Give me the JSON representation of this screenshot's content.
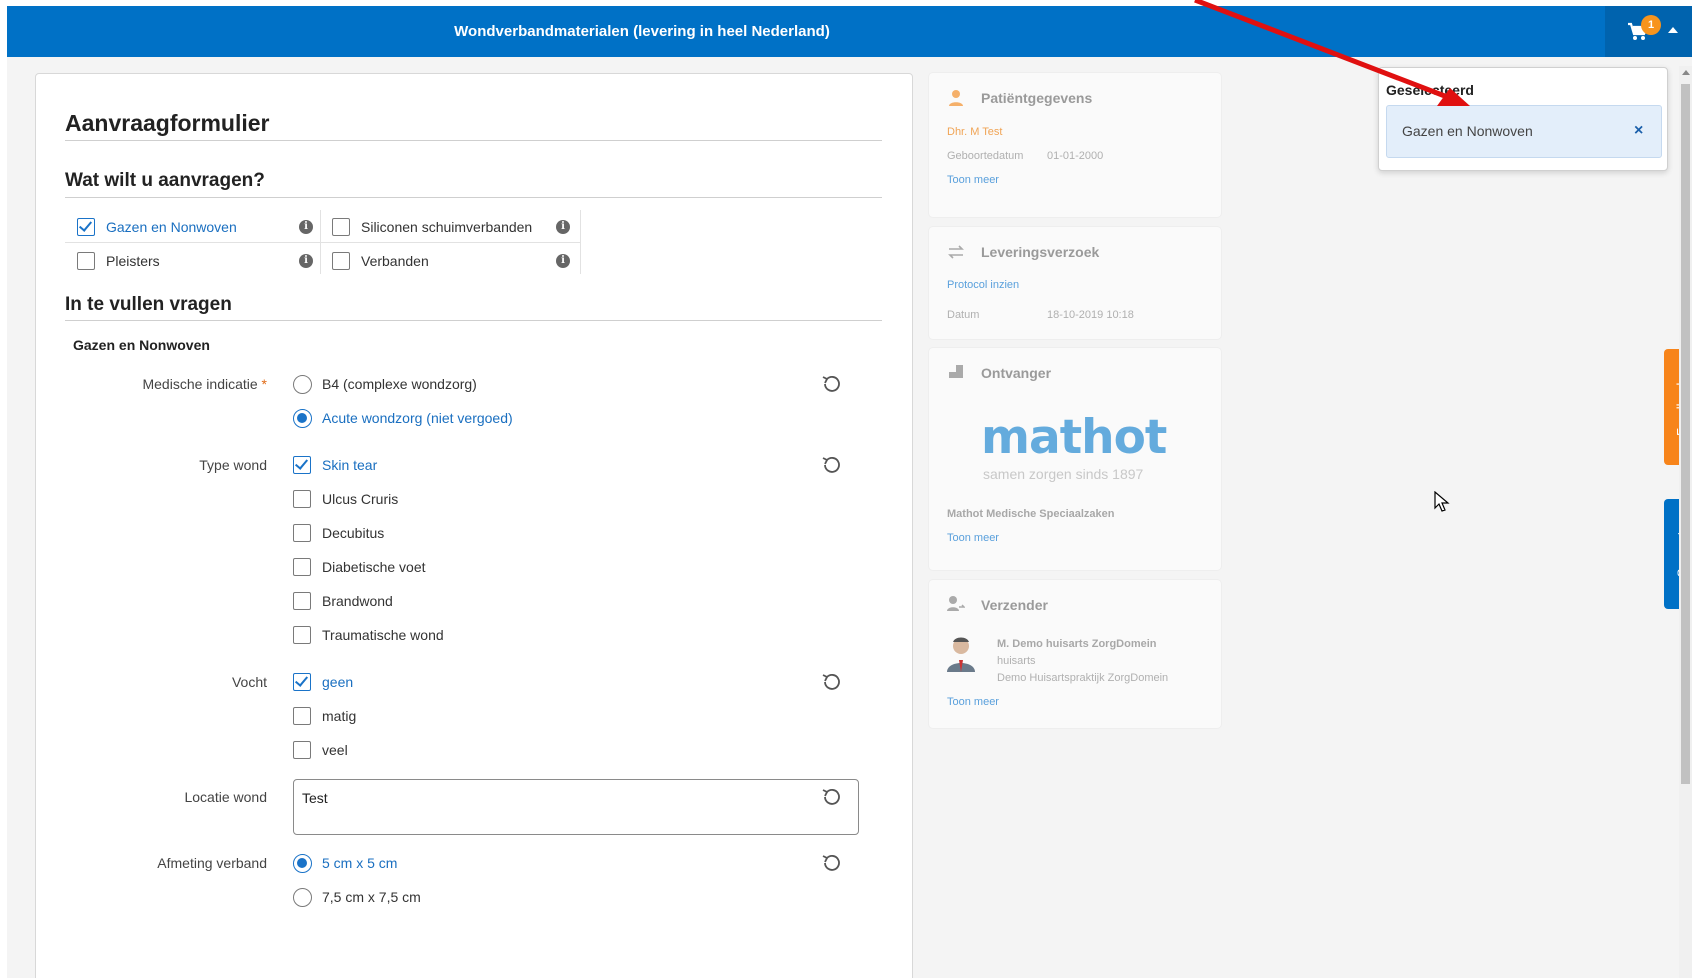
{
  "topbar": {
    "title": "Wondverbandmaterialen (levering in heel Nederland)",
    "cart_count": "1"
  },
  "colors": {
    "primary": "#0071c6",
    "accent": "#f7941d",
    "feedback": "#f7841a"
  },
  "form": {
    "title": "Aanvraagformulier",
    "section1": "Wat wilt u aanvragen?",
    "products": [
      {
        "label": "Gazen en Nonwoven",
        "checked": true
      },
      {
        "label": "Siliconen schuimverbanden",
        "checked": false
      },
      {
        "label": "Pleisters",
        "checked": false
      },
      {
        "label": "Verbanden",
        "checked": false
      }
    ],
    "section2": "In te vullen vragen",
    "subsection": "Gazen en Nonwoven",
    "q_medisch": {
      "label": "Medische indicatie",
      "required_mark": "*",
      "options": [
        "B4 (complexe wondzorg)",
        "Acute wondzorg (niet vergoed)"
      ],
      "selected": "Acute wondzorg (niet vergoed)"
    },
    "q_type": {
      "label": "Type wond",
      "options": [
        "Skin tear",
        "Ulcus Cruris",
        "Decubitus",
        "Diabetische voet",
        "Brandwond",
        "Traumatische wond"
      ],
      "checked": [
        "Skin tear"
      ]
    },
    "q_vocht": {
      "label": "Vocht",
      "options": [
        "geen",
        "matig",
        "veel"
      ],
      "checked": [
        "geen"
      ]
    },
    "q_locatie": {
      "label": "Locatie wond",
      "value": "Test"
    },
    "q_afmeting": {
      "label": "Afmeting verband",
      "options": [
        "5 cm x 5 cm",
        "7,5 cm x 7,5 cm"
      ],
      "selected": "5 cm x 5 cm"
    }
  },
  "sidebar": {
    "patient": {
      "title": "Patiëntgegevens",
      "name": "Dhr. M Test",
      "dob_label": "Geboortedatum",
      "dob": "01-01-2000",
      "more": "Toon meer"
    },
    "delivery": {
      "title": "Leveringsverzoek",
      "protocol": "Protocol inzien",
      "date_label": "Datum",
      "date": "18-10-2019 10:18"
    },
    "receiver": {
      "title": "Ontvanger",
      "logo_text": "mathot",
      "logo_tagline": "samen zorgen sinds 1897",
      "org": "Mathot Medische Speciaalzaken",
      "more": "Toon meer"
    },
    "sender": {
      "title": "Verzender",
      "name": "M. Demo huisarts ZorgDomein",
      "role": "huisarts",
      "practice": "Demo Huisartspraktijk ZorgDomein",
      "more": "Toon meer"
    }
  },
  "popover": {
    "title": "Geselecteerd",
    "item": "Gazen en Nonwoven",
    "close": "×"
  },
  "side_tabs": {
    "feedback": "Feedback",
    "support": "Support"
  }
}
